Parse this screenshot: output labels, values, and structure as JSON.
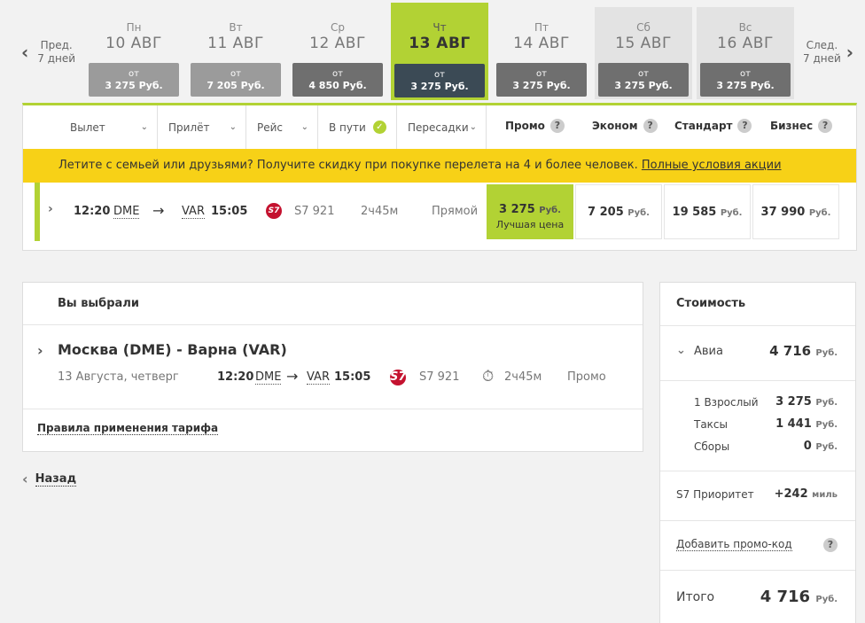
{
  "nav": {
    "prev_line1": "Пред.",
    "prev_line2": "7 дней",
    "next_line1": "След.",
    "next_line2": "7 дней"
  },
  "days": [
    {
      "dow": "Пн",
      "date": "10 АВГ",
      "from": "от",
      "price": "3 275 Руб."
    },
    {
      "dow": "Вт",
      "date": "11 АВГ",
      "from": "от",
      "price": "7 205 Руб."
    },
    {
      "dow": "Ср",
      "date": "12 АВГ",
      "from": "от",
      "price": "4 850 Руб."
    },
    {
      "dow": "Чт",
      "date": "13 АВГ",
      "from": "от",
      "price": "3 275 Руб."
    },
    {
      "dow": "Пт",
      "date": "14 АВГ",
      "from": "от",
      "price": "3 275 Руб."
    },
    {
      "dow": "Сб",
      "date": "15 АВГ",
      "from": "от",
      "price": "3 275 Руб."
    },
    {
      "dow": "Вс",
      "date": "16 АВГ",
      "from": "от",
      "price": "3 275 Руб."
    }
  ],
  "filters": {
    "departure": "Вылет",
    "arrival": "Прилёт",
    "flight": "Рейс",
    "in_transit": "В пути",
    "transfers": "Пересадки"
  },
  "fares": {
    "promo": "Промо",
    "economy": "Эконом",
    "standard": "Стандарт",
    "business": "Бизнес",
    "help": "?"
  },
  "banner": {
    "text": "Летите с семьей или друзьями? Получите скидку при покупке перелета на 4 и более человек. ",
    "link": "Полные условия акции"
  },
  "flight": {
    "dep_time": "12:20",
    "dep_airport": "DME",
    "arrow": "→",
    "arr_airport": "VAR",
    "arr_time": "15:05",
    "airline_logo": "S7",
    "number": "S7 921",
    "duration": "2ч45м",
    "type": "Прямой",
    "promo_price": "3 275",
    "promo_note": "Лучшая цена",
    "economy_price": "7 205",
    "standard_price": "19 585",
    "business_price": "37 990",
    "currency": "Руб."
  },
  "chosen": {
    "title": "Вы выбрали",
    "route": "Москва (DME) - Варна (VAR)",
    "date": "13 Августа, четверг",
    "dep_time": "12:20",
    "dep_airport": "DME",
    "arr_airport": "VAR",
    "arr_time": "15:05",
    "number": "S7 921",
    "duration": "2ч45м",
    "fare": "Промо",
    "rules_link": "Правила применения тарифа"
  },
  "back_label": "Назад",
  "cost": {
    "title": "Стоимость",
    "avia_label": "Авиа",
    "avia_value": "4 716",
    "adult_label": "1 Взрослый",
    "adult_value": "3 275",
    "taxes_label": "Таксы",
    "taxes_value": "1 441",
    "fees_label": "Сборы",
    "fees_value": "0",
    "priority_label": "S7 Приоритет",
    "priority_value": "+242",
    "miles": "миль",
    "promo_code": "Добавить промо-код",
    "total_label": "Итого",
    "total_value": "4 716",
    "currency": "Руб."
  },
  "colors": {
    "accent": "#b2d234",
    "banner": "#f7d117",
    "selected_price_bg": "#3b4a55",
    "s7_red": "#c4122f"
  }
}
